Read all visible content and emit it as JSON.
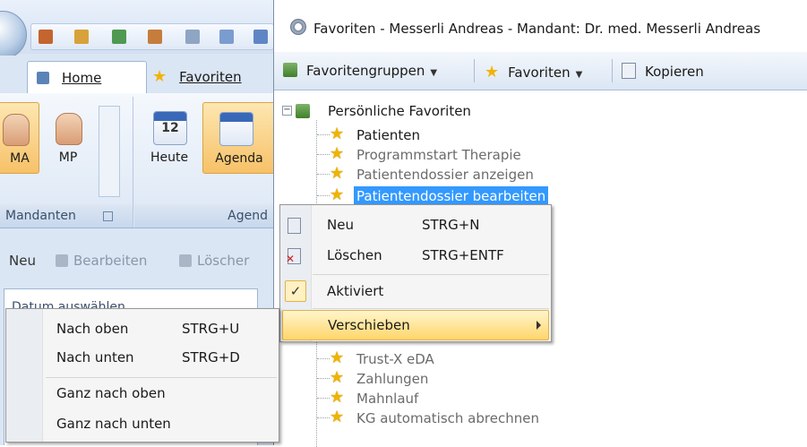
{
  "bg": {
    "tabs": {
      "home": "Home",
      "favoriten": "Favoriten"
    },
    "ribbon": {
      "btn_ma": "MA",
      "btn_mp": "MP",
      "group_mandanten": "Mandanten",
      "btn_heute": "Heute",
      "btn_agenda": "Agenda",
      "group_agenda": "Agend",
      "calendar_day": "12"
    },
    "toolbar": {
      "neu": "Neu",
      "bearbeiten": "Bearbeiten",
      "loeschen": "Löscher"
    },
    "date_panel": {
      "header": "Datum auswählen"
    }
  },
  "favwin": {
    "title": "Favoriten - Messerli Andreas - Mandant: Dr. med. Messerli Andreas",
    "toolbar": {
      "gruppen": "Favoritengruppen",
      "favoriten": "Favoriten",
      "kopieren": "Kopieren"
    },
    "tree": {
      "root": "Persönliche Favoriten",
      "items": [
        {
          "label": "Patienten"
        },
        {
          "label": "Programmstart Therapie"
        },
        {
          "label": "Patientendossier anzeigen"
        },
        {
          "label": "Patientendossier bearbeiten"
        },
        {
          "label": "Trust-X eDA"
        },
        {
          "label": "Zahlungen"
        },
        {
          "label": "Mahnlauf"
        },
        {
          "label": "KG automatisch abrechnen"
        }
      ]
    }
  },
  "context_menu": {
    "items": [
      {
        "label": "Neu",
        "shortcut": "STRG+N"
      },
      {
        "label": "Löschen",
        "shortcut": "STRG+ENTF"
      },
      {
        "label": "Aktiviert"
      },
      {
        "label": "Verschieben"
      }
    ]
  },
  "submenu": {
    "items": [
      {
        "label": "Nach oben",
        "shortcut": "STRG+U"
      },
      {
        "label": "Nach unten",
        "shortcut": "STRG+D"
      },
      {
        "label": "Ganz nach oben"
      },
      {
        "label": "Ganz nach unten"
      }
    ]
  }
}
